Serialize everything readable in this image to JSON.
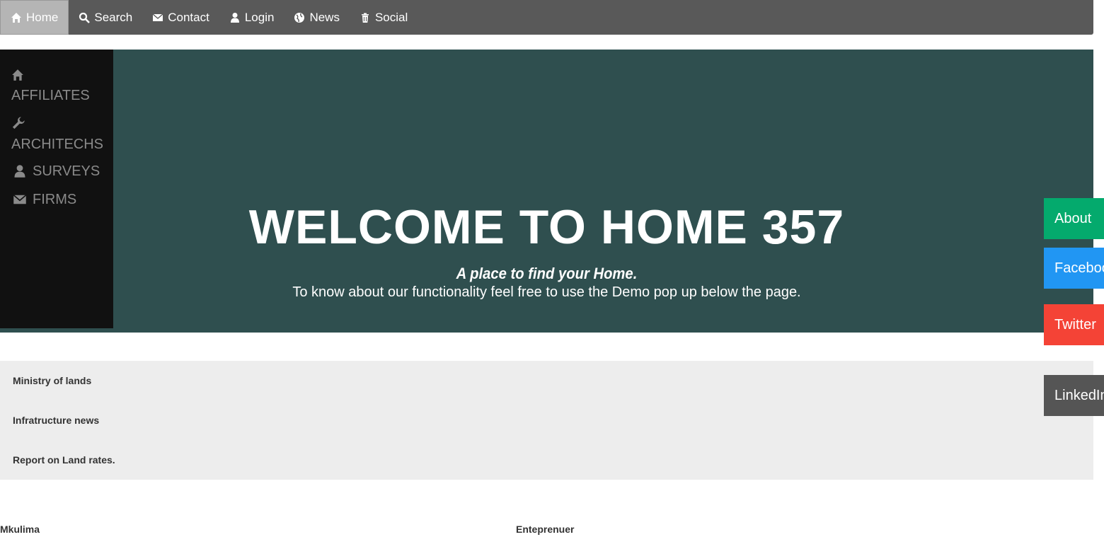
{
  "topnav": {
    "items": [
      {
        "label": "Home",
        "icon": "home-icon"
      },
      {
        "label": "Search",
        "icon": "search-icon"
      },
      {
        "label": "Contact",
        "icon": "envelope-icon"
      },
      {
        "label": "Login",
        "icon": "user-icon"
      },
      {
        "label": "News",
        "icon": "globe-icon"
      },
      {
        "label": "Social",
        "icon": "trash-icon"
      }
    ]
  },
  "sidebar": {
    "items": [
      {
        "label": "AFFILIATES",
        "icon": "home-icon"
      },
      {
        "label": "ARCHITECHS",
        "icon": "wrench-icon"
      },
      {
        "label": "SURVEYS",
        "icon": "user-icon"
      },
      {
        "label": "FIRMS",
        "icon": "envelope-icon"
      }
    ]
  },
  "hero": {
    "title": "WELCOME TO HOME 357",
    "tagline": "A place to find your Home.",
    "description": "To know about our functionality feel free to use the Demo pop up below the page."
  },
  "news": {
    "links": [
      "Ministry of lands",
      "Infratructure news",
      "Report on Land rates."
    ]
  },
  "columns": {
    "left": "Mkulima",
    "right": "Enteprenuer"
  },
  "social": {
    "buttons": [
      {
        "label": "About",
        "color": "#04aa6d"
      },
      {
        "label": "Facebook",
        "color": "#2196f3"
      },
      {
        "label": "Twitter",
        "color": "#f44336"
      },
      {
        "label": "LinkedIn",
        "color": "#555555"
      }
    ]
  },
  "colors": {
    "topnav_bg": "#595959",
    "hero_bg": "#2f4f4f",
    "sidebar_bg": "#111111",
    "news_bg": "#ededed"
  }
}
